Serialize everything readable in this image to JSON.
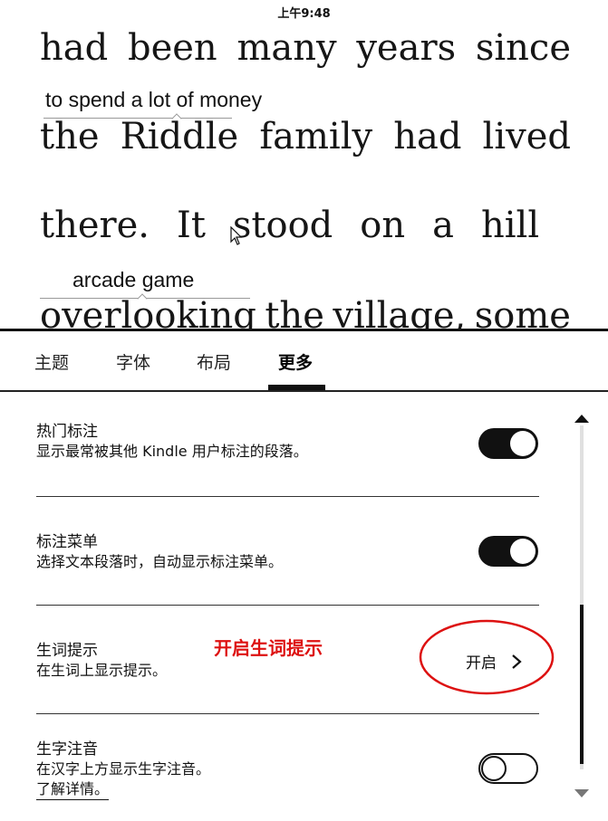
{
  "status_bar": {
    "time": "上午9:48"
  },
  "reader": {
    "lines": [
      [
        "had",
        "been",
        "many",
        "years",
        "since"
      ],
      [
        "the",
        "Riddle",
        "family",
        "had",
        "lived"
      ],
      [
        "there.",
        "It",
        "stood",
        "on",
        "a",
        "hill"
      ],
      [
        "overlooking",
        "the",
        "village,",
        "some"
      ]
    ],
    "word_hints": [
      "to spend a lot of money",
      "arcade game"
    ]
  },
  "tabs": [
    {
      "label": "主题"
    },
    {
      "label": "字体"
    },
    {
      "label": "布局"
    },
    {
      "label": "更多",
      "active": true
    }
  ],
  "settings": [
    {
      "title": "热门标注",
      "description": "显示最常被其他 Kindle 用户标注的段落。",
      "toggle": "on"
    },
    {
      "title": "标注菜单",
      "description": "选择文本段落时，自动显示标注菜单。",
      "toggle": "on"
    },
    {
      "title": "生词提示",
      "description": "在生词上显示提示。",
      "action_label": "开启"
    },
    {
      "title": "生字注音",
      "description": "在汉字上方显示生字注音。",
      "link": "了解详情。",
      "toggle": "off"
    }
  ],
  "annotation": {
    "text": "开启生词提示",
    "color": "#dd1111"
  },
  "icons": {
    "cursor": "mouse-pointer-icon",
    "chevron": "chevron-right-icon",
    "scroll_up": "triangle-up-icon",
    "scroll_down": "triangle-down-icon"
  },
  "colors": {
    "ink": "#111111",
    "annotation_red": "#dd1111",
    "background": "#ffffff"
  }
}
